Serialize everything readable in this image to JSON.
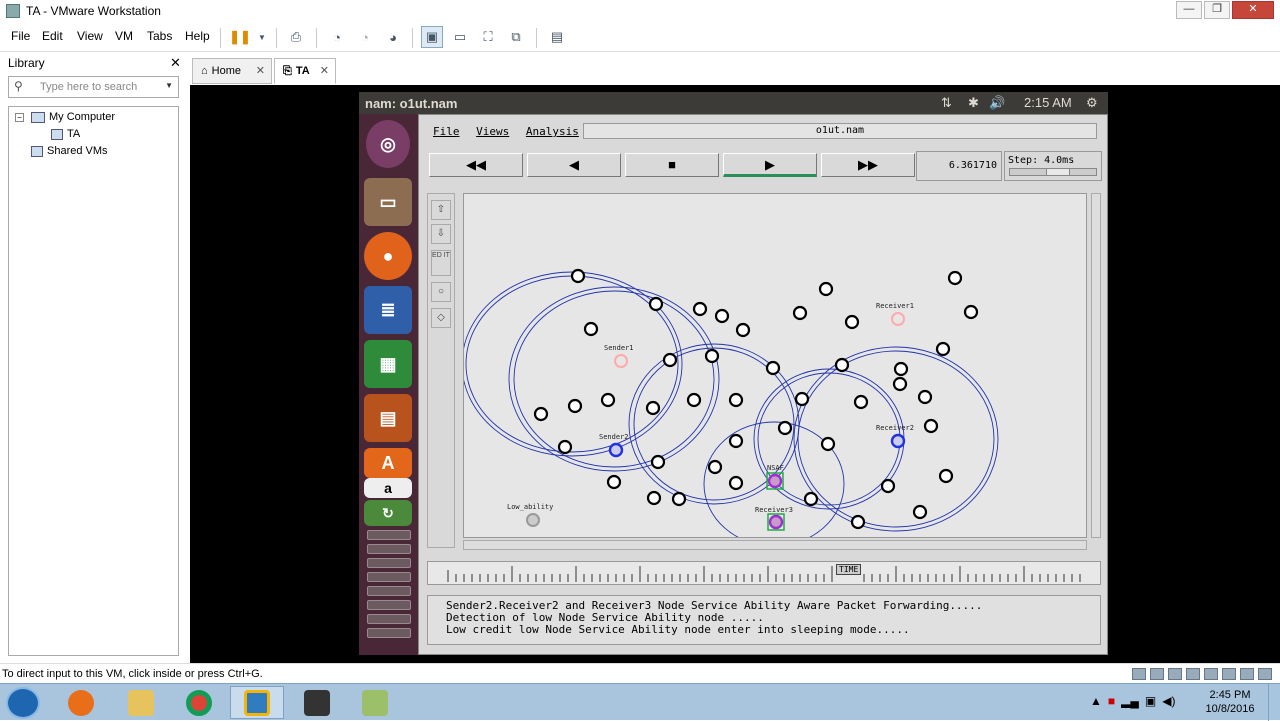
{
  "window": {
    "title": "TA - VMware Workstation",
    "minimize": "—",
    "maximize": "❐",
    "close": "✕"
  },
  "menu": [
    "File",
    "Edit",
    "View",
    "VM",
    "Tabs",
    "Help"
  ],
  "library": {
    "title": "Library",
    "close": "✕",
    "search_placeholder": "Type here to search",
    "tree": {
      "my_computer": "My Computer",
      "vm": "TA",
      "shared": "Shared VMs",
      "expand": "−"
    }
  },
  "tabs": [
    {
      "label": "Home"
    },
    {
      "label": "TA"
    }
  ],
  "tab_close": "✕",
  "ubuntu": {
    "title": "nam: o1ut.nam",
    "time": "2:15 AM",
    "icons": [
      "⇅",
      "✱",
      "🔊",
      "⚙"
    ]
  },
  "nam": {
    "menu": [
      "File",
      "Views",
      "Analysis"
    ],
    "filename": "o1ut.nam",
    "controls": [
      "◀◀",
      "◀",
      "■",
      "▶",
      "▶▶"
    ],
    "time": "6.361710",
    "step": "Step: 4.0ms",
    "side_tools": [
      "⇧",
      "⇩",
      "ED IT",
      "○",
      "◇"
    ],
    "timeline_label": "TIME",
    "log": [
      "Sender2.Receiver2 and Receiver3 Node Service Ability Aware Packet Forwarding.....",
      "Detection of low Node Service Ability node .....",
      "Low credit low Node Service Ability node enter into sleeping mode....."
    ],
    "labels": [
      "Receiver1",
      "Sender1",
      "Sender2",
      "Receiver2",
      "Receiver3",
      "Low_ability",
      "NSAF"
    ],
    "node_colors": {
      "normal": "#000000",
      "sender": "#ff9999",
      "receiver": "#3344dd",
      "nsaf": "#9933cc",
      "low": "#999999"
    }
  },
  "status": {
    "text": "To direct input to this VM, click inside or press Ctrl+G."
  },
  "taskbar": {
    "time": "2:45 PM",
    "date": "10/8/2016"
  }
}
